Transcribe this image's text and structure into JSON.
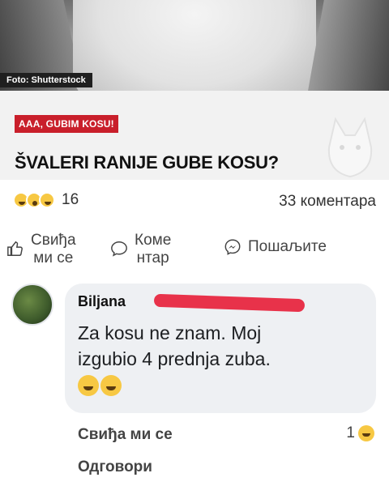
{
  "photo": {
    "credit": "Foto: Shutterstock"
  },
  "article": {
    "badge": "AAA, GUBIM KOSU!",
    "headline": "ŠVALERI RANIJE GUBE KOSU?"
  },
  "stats": {
    "reaction_icons": [
      "laugh-emoji-icon",
      "wow-emoji-icon",
      "shocked-emoji-icon"
    ],
    "reaction_count": "16",
    "comments": "33 коментара"
  },
  "actions": {
    "like_line1": "Свиђа",
    "like_line2": "ми се",
    "comment_line1": "Коме",
    "comment_line2": "нтар",
    "share": "Пошаљите"
  },
  "comment": {
    "author": "Biljana",
    "text_line1": "Za kosu ne znam. Moj",
    "text_line2": "izgubio 4 prednja zuba.",
    "emojis": [
      "wink-emoji-icon",
      "laughing-crying-emoji-icon"
    ],
    "like_label": "Свиђа ми се",
    "reply_label": "Одговори",
    "like_count": "1"
  },
  "colors": {
    "badge": "#c91f2b",
    "redaction": "#e8324a",
    "bubble": "#eef0f3"
  }
}
